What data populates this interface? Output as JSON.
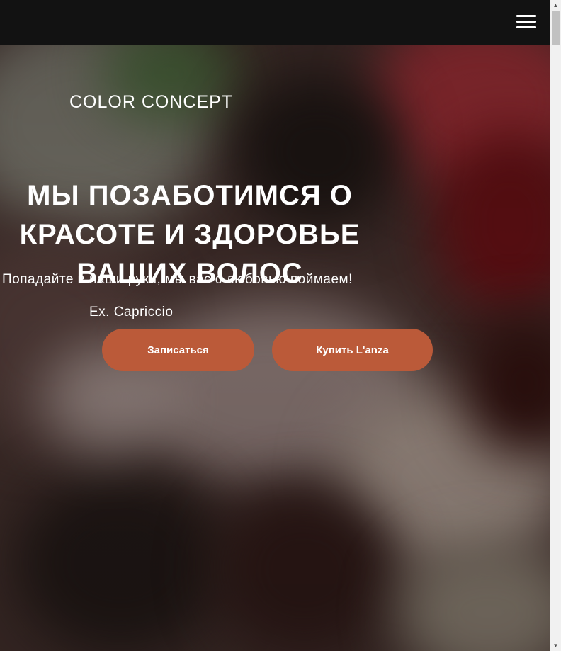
{
  "header": {
    "menu_icon": "hamburger-menu-icon"
  },
  "hero": {
    "brand": "COLOR CONCEPT",
    "headline": "МЫ ПОЗАБОТИМСЯ О КРАСОТЕ И ЗДОРОВЬЕ ВАШИХ ВОЛОС",
    "subtitle": "Попадайте в наши руки, мы вас с любовью поймаем!",
    "former_name": "Ex. Capriccio",
    "book_button": "Записаться",
    "buy_button": "Купить L'anza"
  },
  "colors": {
    "topbar": "#121212",
    "button": "#bb5a39",
    "text": "#ffffff"
  },
  "scrollbar": {
    "up_icon": "scroll-up-arrow-icon",
    "down_icon": "scroll-down-arrow-icon"
  }
}
